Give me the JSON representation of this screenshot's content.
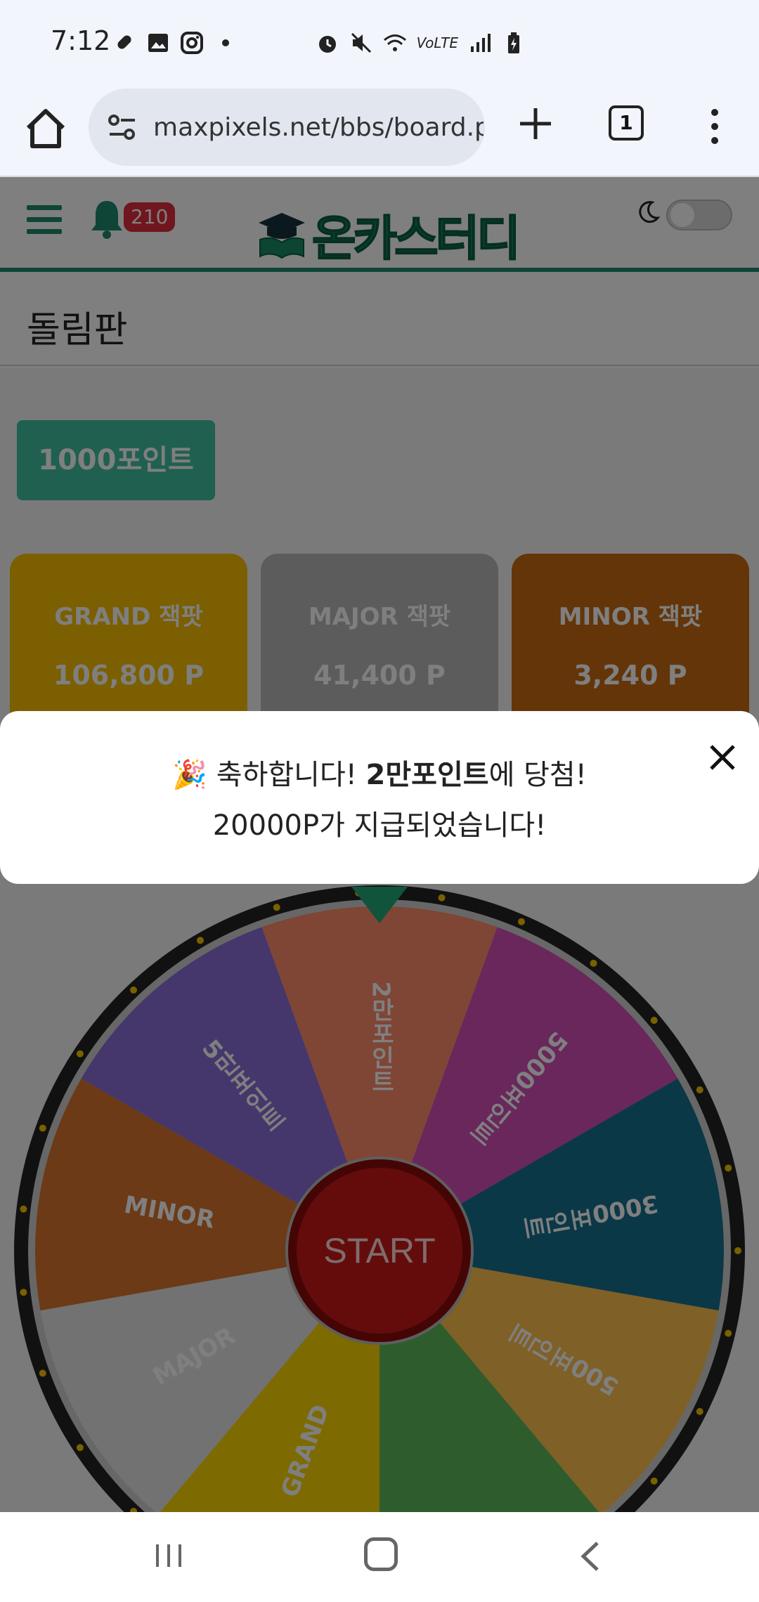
{
  "status_bar": {
    "time": "7:12",
    "left_icons": [
      "pill-icon",
      "image-icon",
      "instagram-icon",
      "dot-icon"
    ],
    "right_icons": [
      "alarm-icon",
      "mute-icon",
      "wifi-icon",
      "volte-icon",
      "signal-icon",
      "battery-icon"
    ],
    "volte_label": "VoLTE"
  },
  "browser": {
    "url": "maxpixels.net/bbs/board.php",
    "tab_count": "1"
  },
  "site": {
    "notification_count": "210",
    "logo_text": "온카스터디",
    "page_title": "돌림판",
    "points_button": "1000포인트",
    "jackpots": [
      {
        "title": "GRAND 잭팟",
        "value": "106,800 P",
        "color": "#f6bf00"
      },
      {
        "title": "MAJOR 잭팟",
        "value": "41,400 P",
        "color": "#b9b9b9"
      },
      {
        "title": "MINOR 잭팟",
        "value": "3,240 P",
        "color": "#c86a12"
      }
    ],
    "wheel": {
      "start_label": "START",
      "segments": [
        {
          "label": "2만포인트",
          "color": "#ff8a6a"
        },
        {
          "label": "5000포인트",
          "color": "#d24fb8"
        },
        {
          "label": "3000포인트",
          "color": "#17708f"
        },
        {
          "label": "500포인트",
          "color": "#ffc14f"
        },
        {
          "label": "",
          "color": "#5fb85a"
        },
        {
          "label": "GRAND",
          "color": "#fad400"
        },
        {
          "label": "MAJOR",
          "color": "#e5e5e5"
        },
        {
          "label": "MINOR",
          "color": "#d8752c"
        },
        {
          "label": "5만포인트",
          "color": "#8b6fd8"
        }
      ]
    }
  },
  "toast": {
    "emoji": "🎉",
    "line1_prefix": "축하합니다!",
    "line1_bold": "2만포인트",
    "line1_suffix": "에 당첨!",
    "line2": "20000P가 지급되었습니다!"
  }
}
